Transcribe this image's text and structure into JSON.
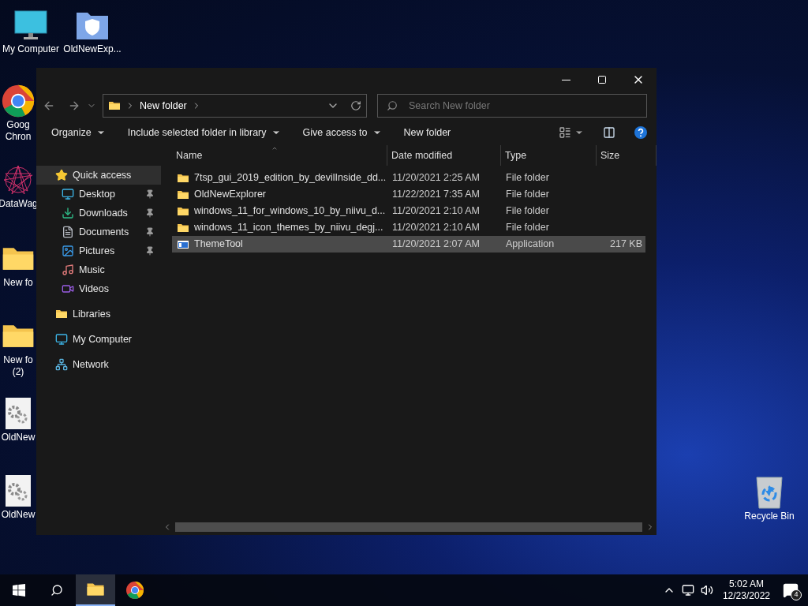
{
  "desktop_icons": [
    {
      "kind": "computer",
      "lines": [
        "My Computer"
      ]
    },
    {
      "kind": "shield-folder",
      "lines": [
        "OldNewExp..."
      ]
    },
    {
      "kind": "browser",
      "lines": [
        "Goog",
        "Chron"
      ]
    },
    {
      "kind": "art",
      "lines": [
        "DataWag"
      ]
    },
    {
      "kind": "folder",
      "lines": [
        "New fo"
      ]
    },
    {
      "kind": "folder",
      "lines": [
        "New fo",
        "(2)"
      ]
    },
    {
      "kind": "app",
      "lines": [
        "OldNew"
      ]
    },
    {
      "kind": "app",
      "lines": [
        "OldNew"
      ]
    },
    {
      "kind": "recycle",
      "lines": [
        "Recycle Bin"
      ]
    }
  ],
  "window": {
    "address": {
      "path": [
        "New folder"
      ]
    },
    "search": {
      "placeholder": "Search New folder"
    },
    "toolbar": [
      {
        "label": "Organize",
        "dropdown": true
      },
      {
        "label": "Include selected folder in library",
        "dropdown": true
      },
      {
        "label": "Give access to",
        "dropdown": true
      },
      {
        "label": "New folder",
        "dropdown": false
      }
    ],
    "navigation": [
      {
        "label": "Quick access",
        "kind": "star",
        "selected": true,
        "children": [
          {
            "label": "Desktop",
            "kind": "desktop",
            "pinned": true,
            "selected": false
          },
          {
            "label": "Downloads",
            "kind": "download",
            "pinned": true,
            "selected": false
          },
          {
            "label": "Documents",
            "kind": "document",
            "pinned": true,
            "selected": false
          },
          {
            "label": "Pictures",
            "kind": "picture",
            "pinned": true,
            "selected": false
          },
          {
            "label": "Music",
            "kind": "music",
            "pinned": false,
            "selected": false
          },
          {
            "label": "Videos",
            "kind": "video",
            "pinned": false,
            "selected": false
          }
        ]
      },
      {
        "label": "Libraries",
        "kind": "folder",
        "selected": false
      },
      {
        "label": "My Computer",
        "kind": "computer",
        "selected": false
      },
      {
        "label": "Network",
        "kind": "network",
        "selected": false
      }
    ],
    "columns": [
      {
        "label": "Name",
        "sorted": true
      },
      {
        "label": "Date modified",
        "sorted": false
      },
      {
        "label": "Type",
        "sorted": false
      },
      {
        "label": "Size",
        "sorted": false
      }
    ],
    "rows": [
      {
        "kind": "folder",
        "name": "7tsp_gui_2019_edition_by_devilInside_dd...",
        "date": "11/20/2021 2:25 AM",
        "type": "File folder",
        "selected": false
      },
      {
        "kind": "folder",
        "name": "OldNewExplorer",
        "date": "11/22/2021 7:35 AM",
        "type": "File folder",
        "selected": false
      },
      {
        "kind": "folder",
        "name": "windows_11_for_windows_10_by_niivu_d...",
        "date": "11/20/2021 2:10 AM",
        "type": "File folder",
        "selected": false
      },
      {
        "kind": "folder",
        "name": "windows_11_icon_themes_by_niivu_degj...",
        "date": "11/20/2021 2:10 AM",
        "type": "File folder",
        "selected": false
      },
      {
        "kind": "application",
        "name": "ThemeTool",
        "date": "11/20/2021 2:07 AM",
        "type": "Application",
        "size": "217 KB",
        "selected": true
      }
    ]
  },
  "taskbar": {
    "apps": [
      {
        "kind": "explorer",
        "active": true
      },
      {
        "kind": "browser",
        "active": false
      }
    ],
    "time": "5:02 AM",
    "date": "12/23/2022",
    "notifications": "4"
  }
}
